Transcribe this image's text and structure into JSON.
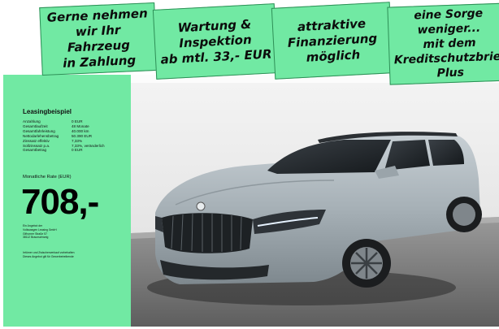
{
  "banners": [
    {
      "text": "Gerne nehmen\nwir Ihr\nFahrzeug\nin Zahlung"
    },
    {
      "text": "Wartung &\nInspektion\nab mtl. 33,- EUR"
    },
    {
      "text": "attraktive\nFinanzierung\nmöglich"
    },
    {
      "text": "eine Sorge weniger...\nmit dem\nKreditschutzbrief\nPlus"
    }
  ],
  "leasing": {
    "title": "Leasingbeispiel",
    "rows": [
      {
        "label": "Anzahlung",
        "value": "0 EUR"
      },
      {
        "label": "Gesamtlaufzeit",
        "value": "48 Monate"
      },
      {
        "label": "Gesamtfahrleistung",
        "value": "40.000 km"
      },
      {
        "label": "Nettodarlehensbetrag",
        "value": "50.390 EUR"
      },
      {
        "label": "Zinssatz effektiv",
        "value": "7,33%"
      },
      {
        "label": "Sollzinssatz p.a.",
        "value": "7,33%, veränderlich"
      },
      {
        "label": "Gesamtbetrag",
        "value": "0 EUR"
      }
    ],
    "rate_label": "Monatliche Rate (EUR)",
    "price": "708,-",
    "dealer_lines": [
      "Ein Angebot der",
      "Volkswagen Leasing GmbH",
      "Gifhorner Straße 57",
      "38112 Braunschweig"
    ],
    "fine_lines": [
      "Irrtümer und Zwischenverkauf vorbehalten",
      "Dieses Angebot gilt für Gewerbetreibende"
    ]
  },
  "colors": {
    "accent": "#71e9a3",
    "car_body": "#a9b3b9"
  }
}
